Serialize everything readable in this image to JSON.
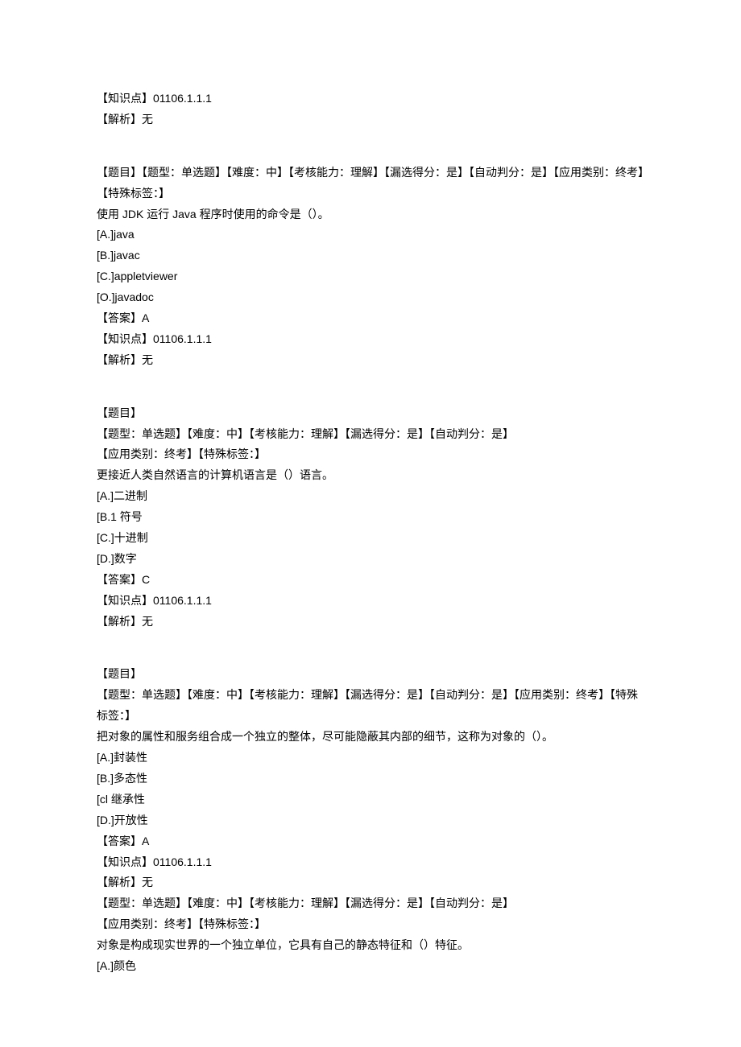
{
  "blocks": [
    {
      "lines": [
        "【知识点】01106.1.1.1",
        "【解析】无"
      ]
    },
    {
      "lines": [
        "【题目】【题型：单选题】【难度：中】【考核能力：理解】【漏选得分：是】【自动判分：是】【应用类别：终考】【特殊标签：】",
        "使用 JDK 运行 Java 程序时使用的命令是（）。",
        "[A.]java",
        "[B.]javac",
        "[C.]appletviewer",
        "[O.]javadoc",
        "【答案】A",
        "【知识点】01106.1.1.1",
        "【解析】无"
      ]
    },
    {
      "lines": [
        "【题目】",
        "【题型：单选题】【难度：中】【考核能力：理解】【漏选得分：是】【自动判分：是】",
        "【应用类别：终考】【特殊标签：】",
        "更接近人类自然语言的计算机语言是（）语言。",
        "[A.]二进制",
        "[B.1 符号",
        "[C.]十进制",
        "[D.]数字",
        "【答案】C",
        "【知识点】01106.1.1.1",
        "【解析】无"
      ]
    },
    {
      "lines": [
        "【题目】",
        "【题型：单选题】【难度：中】【考核能力：理解】【漏选得分：是】【自动判分：是】【应用类别：终考】【特殊标签：】",
        "把对象的属性和服务组合成一个独立的整体，尽可能隐蔽其内部的细节，这称为对象的（）。",
        "[A.]封装性",
        "[B.]多态性",
        "[cl 继承性",
        "[D.]开放性",
        "【答案】A",
        "【知识点】01106.1.1.1",
        "【解析】无",
        "【题型：单选题】【难度：中】【考核能力：理解】【漏选得分：是】【自动判分：是】",
        "【应用类别：终考】【特殊标签：】",
        "对象是构成现实世界的一个独立单位，它具有自己的静态特征和（）特征。",
        "[A.]颜色"
      ]
    }
  ]
}
